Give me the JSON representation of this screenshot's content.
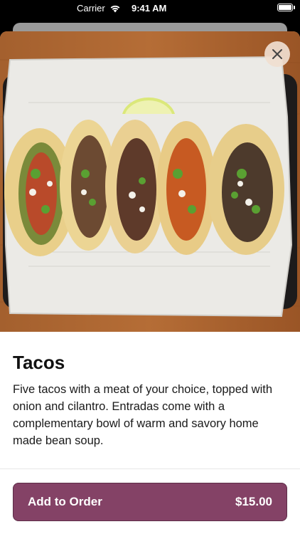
{
  "status_bar": {
    "carrier": "Carrier",
    "time": "9:41 AM",
    "wifi_icon": "wifi-icon",
    "battery_icon": "battery-icon"
  },
  "hero": {
    "image_subject": "five tacos in a basket lined with paper, with a lime wedge",
    "close_icon": "close-icon"
  },
  "item": {
    "title": "Tacos",
    "description": "Five tacos with a meat of your choice, topped with onion and cilantro. Entradas come with a complementary bowl of warm and savory home made bean soup."
  },
  "order_button": {
    "label": "Add to Order",
    "price": "$15.00",
    "color": "#844266"
  }
}
